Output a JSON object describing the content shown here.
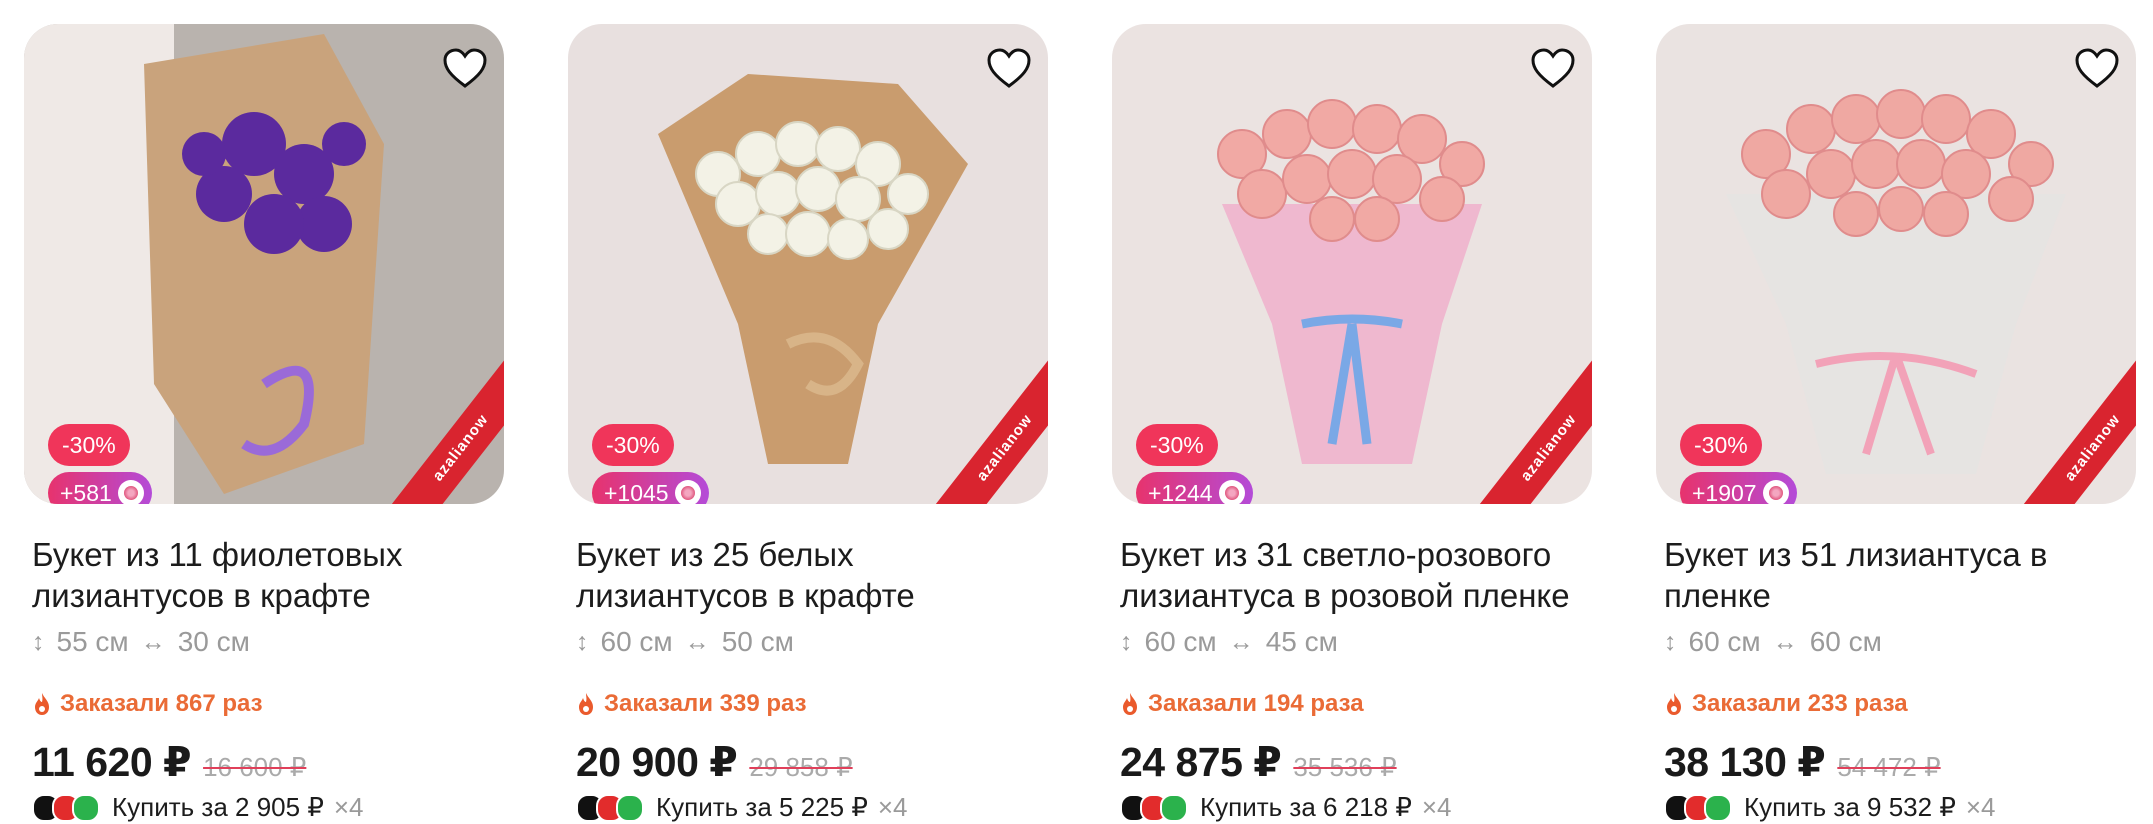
{
  "products": [
    {
      "discount": "-30%",
      "bonus": "+581",
      "title": "Букет из 11 фиолетовых лизиантусов в крафте",
      "height": "55 см",
      "width": "30 см",
      "ordered": "Заказали 867 раз",
      "price": "11 620 ₽",
      "old_price": "16 600 ₽",
      "split_label": "Купить за 2 905 ₽",
      "split_mult": "×4",
      "brand": "azalianow",
      "colors": {
        "bg": "#b9b3ae",
        "flower": "#5b2a9e",
        "wrap": "#c9a37c",
        "ribbon": "#9a6ad8"
      }
    },
    {
      "discount": "-30%",
      "bonus": "+1045",
      "title": "Букет из 25 белых лизиантусов в крафте",
      "height": "60 см",
      "width": "50 см",
      "ordered": "Заказали 339 раз",
      "price": "20 900 ₽",
      "old_price": "29 858 ₽",
      "split_label": "Купить за 5 225 ₽",
      "split_mult": "×4",
      "brand": "azalianow",
      "colors": {
        "bg": "#e8e0df",
        "flower": "#f3f2e6",
        "wrap": "#c99c6e",
        "ribbon": "#d8b488"
      }
    },
    {
      "discount": "-30%",
      "bonus": "+1244",
      "title": "Букет из 31 светло-розового лизиантуса в розовой пленке",
      "height": "60 см",
      "width": "45 см",
      "ordered": "Заказали 194 раза",
      "price": "24 875 ₽",
      "old_price": "35 536 ₽",
      "split_label": "Купить за 6 218 ₽",
      "split_mult": "×4",
      "brand": "azalianow",
      "colors": {
        "bg": "#ebe3e1",
        "flower": "#f1a9a4",
        "wrap": "#efb8cf",
        "ribbon": "#7aa8e6"
      }
    },
    {
      "discount": "-30%",
      "bonus": "+1907",
      "title": "Букет из 51 лизиантуса в пленке",
      "height": "60 см",
      "width": "60 см",
      "ordered": "Заказали 233 раза",
      "price": "38 130 ₽",
      "old_price": "54 472 ₽",
      "split_label": "Купить за 9 532 ₽",
      "split_mult": "×4",
      "brand": "azalianow",
      "colors": {
        "bg": "#eae3e1",
        "flower": "#efa8a2",
        "wrap": "#e6e3e2",
        "ribbon": "#f2a2b8"
      }
    }
  ],
  "icons": {
    "favorite": "heart-outline-icon",
    "height": "vertical-arrows-icon",
    "width": "horizontal-arrows-icon",
    "hot": "flame-icon"
  }
}
